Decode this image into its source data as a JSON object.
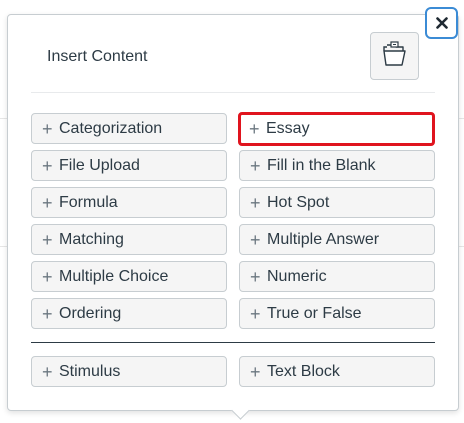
{
  "dialog": {
    "title": "Insert Content",
    "close_icon": "close-icon",
    "folder_icon": "folder-open-icon"
  },
  "content_types": {
    "left": [
      {
        "label": "Categorization"
      },
      {
        "label": "File Upload"
      },
      {
        "label": "Formula"
      },
      {
        "label": "Matching"
      },
      {
        "label": "Multiple Choice"
      },
      {
        "label": "Ordering"
      }
    ],
    "right": [
      {
        "label": "Essay",
        "highlighted": true
      },
      {
        "label": "Fill in the Blank"
      },
      {
        "label": "Hot Spot"
      },
      {
        "label": "Multiple Answer"
      },
      {
        "label": "Numeric"
      },
      {
        "label": "True or False"
      }
    ]
  },
  "other_types": {
    "left": {
      "label": "Stimulus"
    },
    "right": {
      "label": "Text Block"
    }
  },
  "colors": {
    "highlight_border": "#e0141e",
    "focus_ring": "#3b8bd5",
    "text": "#2d3b45"
  }
}
